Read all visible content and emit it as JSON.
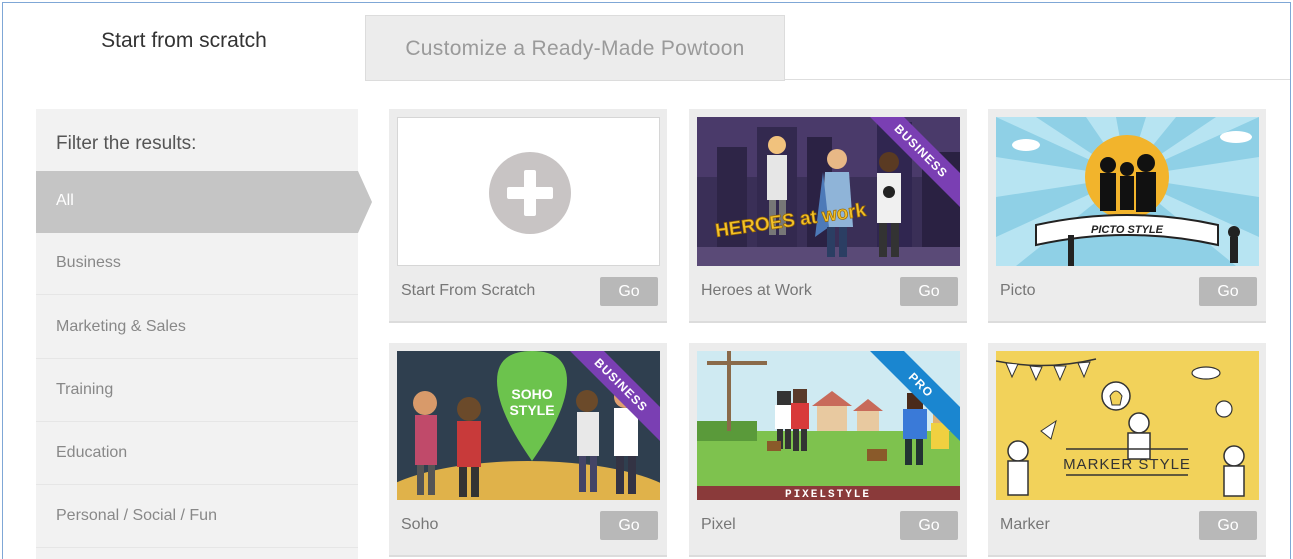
{
  "tabs": {
    "active": "Start from scratch",
    "inactive": "Customize a Ready-Made Powtoon"
  },
  "sidebar": {
    "title": "Filter the results:",
    "items": [
      {
        "label": "All",
        "active": true
      },
      {
        "label": "Business"
      },
      {
        "label": "Marketing & Sales"
      },
      {
        "label": "Training"
      },
      {
        "label": "Education"
      },
      {
        "label": "Personal / Social / Fun"
      }
    ]
  },
  "cards": [
    {
      "title": "Start From Scratch",
      "go": "Go"
    },
    {
      "title": "Heroes at Work",
      "go": "Go",
      "badge": "BUSINESS",
      "thumb_text": "HEROES at work"
    },
    {
      "title": "Picto",
      "go": "Go",
      "thumb_text": "PICTO STYLE"
    },
    {
      "title": "Soho",
      "go": "Go",
      "badge": "BUSINESS",
      "thumb_text_1": "SOHO",
      "thumb_text_2": "STYLE"
    },
    {
      "title": "Pixel",
      "go": "Go",
      "badge": "PRO",
      "thumb_text": "PIXELSTYLE"
    },
    {
      "title": "Marker",
      "go": "Go",
      "thumb_text": "MARKER STYLE"
    }
  ],
  "colors": {
    "business_badge": "#7a3fb3",
    "pro_badge": "#1a86d0",
    "go_button": "#b8b8b8",
    "active_filter": "#c5c5c5"
  }
}
